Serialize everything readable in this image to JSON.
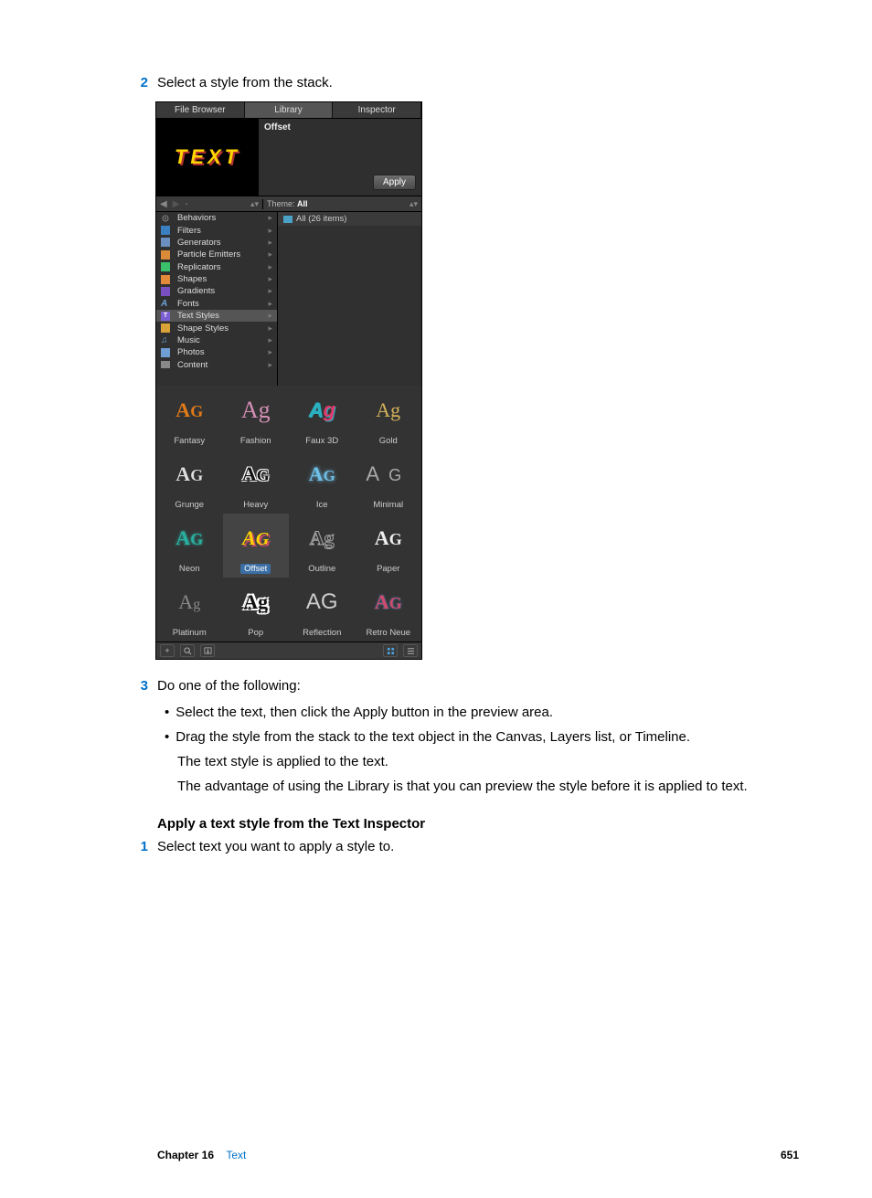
{
  "step2": {
    "num": "2",
    "text": "Select a style from the stack."
  },
  "step3": {
    "num": "3",
    "text": "Do one of the following:",
    "bullets": [
      "Select the text, then click the Apply button in the preview area.",
      "Drag the style from the stack to the text object in the Canvas, Layers list, or Timeline."
    ],
    "result": "The text style is applied to the text.",
    "advantage": "The advantage of using the Library is that you can preview the style before it is applied to text."
  },
  "section": {
    "heading": "Apply a text style from the Text Inspector",
    "step1_num": "1",
    "step1_text": "Select text you want to apply a style to."
  },
  "panel": {
    "tabs": [
      "File Browser",
      "Library",
      "Inspector"
    ],
    "active_tab": 1,
    "preview_title": "Offset",
    "preview_word": "TEXT",
    "apply_label": "Apply",
    "theme_label": "Theme:",
    "theme_value": "All",
    "categories": [
      {
        "name": "Behaviors",
        "icon": "gear",
        "color": "#888"
      },
      {
        "name": "Filters",
        "icon": "sq",
        "color": "#3a7fbf"
      },
      {
        "name": "Generators",
        "icon": "sq",
        "color": "#6a8fbf"
      },
      {
        "name": "Particle Emitters",
        "icon": "sq",
        "color": "#d98b3a"
      },
      {
        "name": "Replicators",
        "icon": "sq",
        "color": "#3abf6a"
      },
      {
        "name": "Shapes",
        "icon": "sq",
        "color": "#e08a3a"
      },
      {
        "name": "Gradients",
        "icon": "sq",
        "color": "#7a4fbf"
      },
      {
        "name": "Fonts",
        "icon": "A",
        "color": "#6fa0d4"
      },
      {
        "name": "Text Styles",
        "icon": "T",
        "color": "#7a5fd4",
        "selected": true
      },
      {
        "name": "Shape Styles",
        "icon": "sq",
        "color": "#d9a33a"
      },
      {
        "name": "Music",
        "icon": "note",
        "color": "#6fa0d4"
      },
      {
        "name": "Photos",
        "icon": "sq",
        "color": "#6fa0d4"
      },
      {
        "name": "Content",
        "icon": "folder",
        "color": "#888"
      }
    ],
    "right_header": "All (26 items)",
    "styles": [
      {
        "name": "Fantasy"
      },
      {
        "name": "Fashion"
      },
      {
        "name": "Faux 3D"
      },
      {
        "name": "Gold"
      },
      {
        "name": "Grunge"
      },
      {
        "name": "Heavy"
      },
      {
        "name": "Ice"
      },
      {
        "name": "Minimal"
      },
      {
        "name": "Neon"
      },
      {
        "name": "Offset",
        "selected": true
      },
      {
        "name": "Outline"
      },
      {
        "name": "Paper"
      },
      {
        "name": "Platinum"
      },
      {
        "name": "Pop"
      },
      {
        "name": "Reflection"
      },
      {
        "name": "Retro Neue"
      }
    ]
  },
  "footer": {
    "chapter": "Chapter 16",
    "link": "Text",
    "page": "651"
  }
}
